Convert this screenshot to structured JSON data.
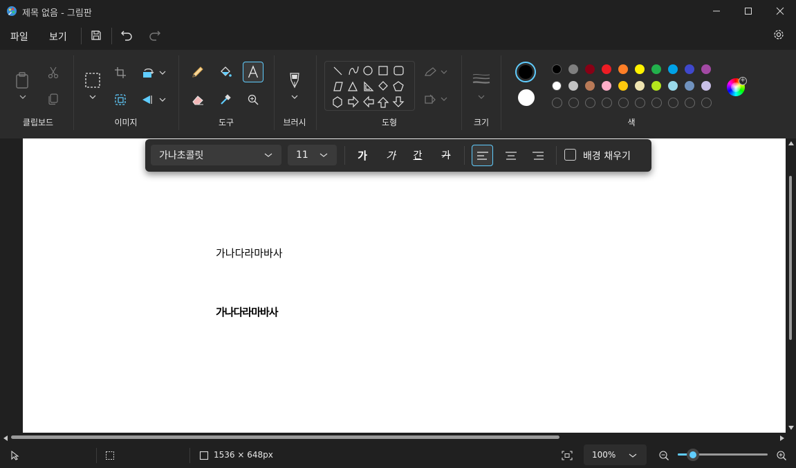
{
  "window": {
    "title": "제목 없음 - 그림판"
  },
  "menu": {
    "file": "파일",
    "view": "보기"
  },
  "ribbon": {
    "groups": {
      "clipboard": "클립보드",
      "image": "이미지",
      "tools": "도구",
      "brushes": "브러시",
      "shapes": "도형",
      "size": "크기",
      "colors": "색"
    }
  },
  "colors": {
    "primary": "#000000",
    "secondary": "#ffffff",
    "palette_row1": [
      "#000000",
      "#7f7f7f",
      "#880015",
      "#ed1c24",
      "#ff7f27",
      "#fff200",
      "#22b14c",
      "#00a2e8",
      "#3f48cc",
      "#a349a4"
    ],
    "palette_row2": [
      "#ffffff",
      "#c3c3c3",
      "#b97a57",
      "#ffaec9",
      "#ffc90e",
      "#efe4b0",
      "#b5e61d",
      "#99d9ea",
      "#7092be",
      "#c8bfe7"
    ],
    "accent": "#60cdff"
  },
  "text_toolbar": {
    "font": "가나초콜릿",
    "size": "11",
    "bold": "가",
    "italic": "가",
    "underline": "간",
    "strikethrough": "가",
    "fill_background": "배경 채우기"
  },
  "canvas_text": {
    "line1": "가나다라마바사",
    "line2": "가나다라마바사"
  },
  "status": {
    "dimensions": "1536 × 648px",
    "zoom": "100%",
    "zoom_fraction": 0.17
  }
}
